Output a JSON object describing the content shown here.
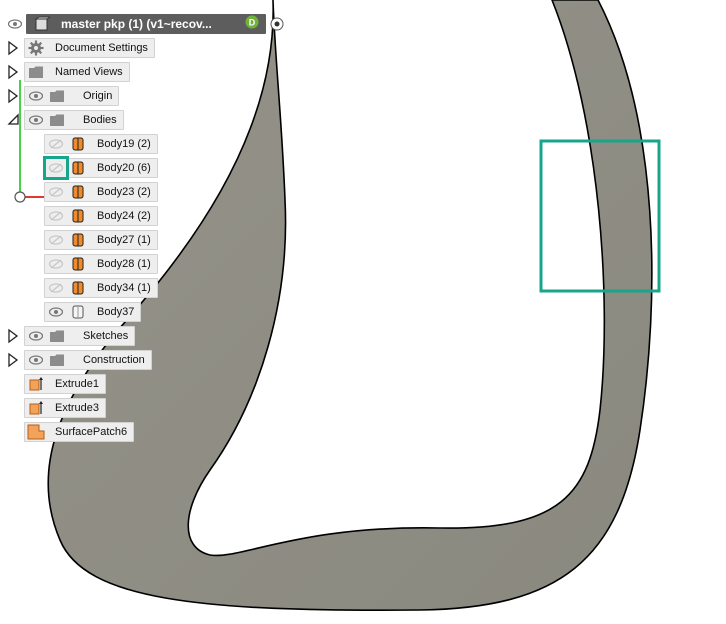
{
  "browser": {
    "root": {
      "title": "master pkp (1) (v1~recov..."
    },
    "items": [
      {
        "label": "Document Settings"
      },
      {
        "label": "Named Views"
      },
      {
        "label": "Origin"
      },
      {
        "label": "Bodies"
      },
      {
        "label": "Body19 (2)"
      },
      {
        "label": "Body20 (6)"
      },
      {
        "label": "Body23 (2)"
      },
      {
        "label": "Body24 (2)"
      },
      {
        "label": "Body27 (1)"
      },
      {
        "label": "Body28 (1)"
      },
      {
        "label": "Body34 (1)"
      },
      {
        "label": "Body37"
      },
      {
        "label": "Sketches"
      },
      {
        "label": "Construction"
      },
      {
        "label": "Extrude1"
      },
      {
        "label": "Extrude3"
      },
      {
        "label": "SurfacePatch6"
      }
    ]
  },
  "colors": {
    "model_fill": "#8f8e85",
    "highlight": "#17a58c",
    "body_orange": "#f08a2a"
  }
}
